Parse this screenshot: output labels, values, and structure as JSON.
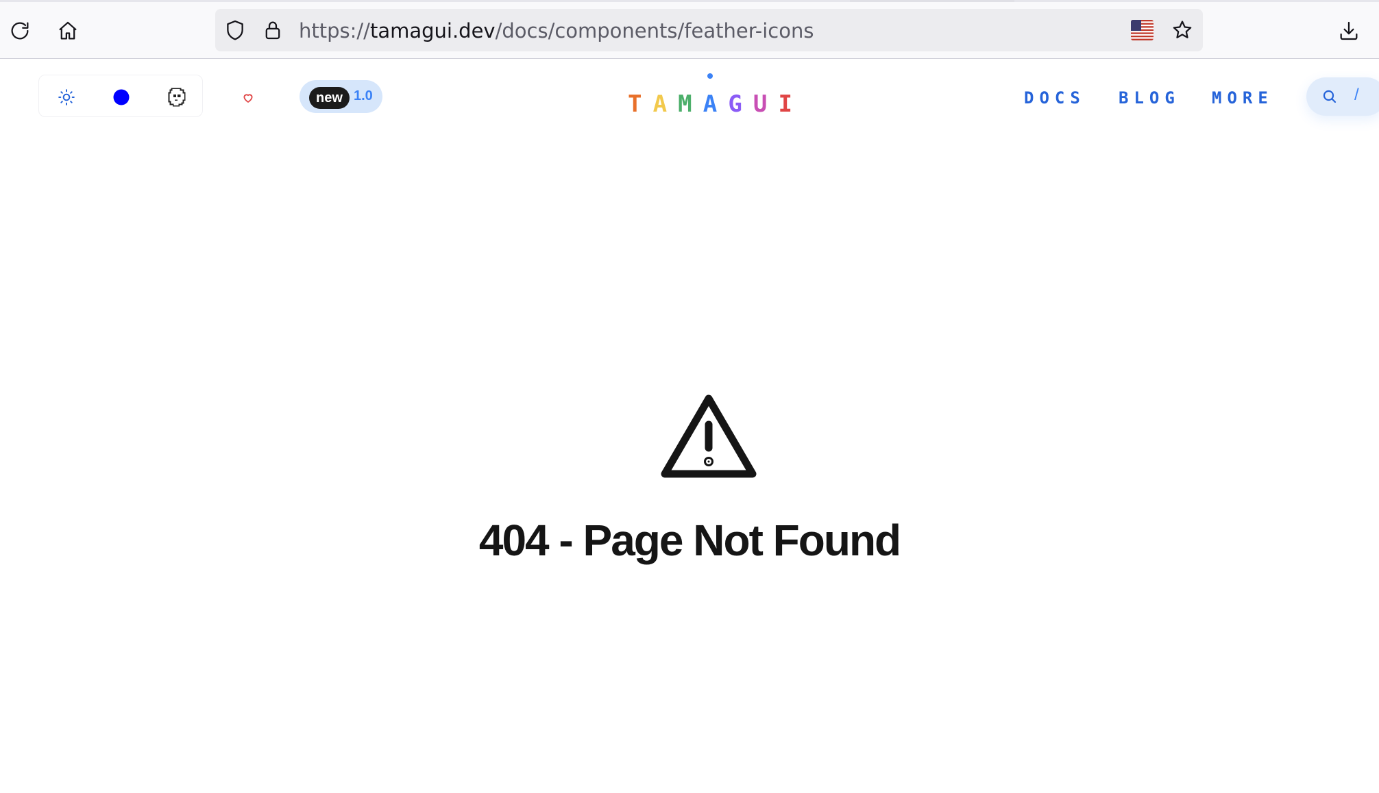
{
  "browser": {
    "url_scheme": "https://",
    "url_host": "tamagui.dev",
    "url_path": "/docs/components/feather-icons",
    "icons": [
      "reload-icon",
      "home-icon",
      "shield-icon",
      "lock-icon",
      "us-flag-icon",
      "star-icon",
      "download-icon"
    ]
  },
  "nav": {
    "new_badge": "new",
    "new_version": "1.0",
    "logo_letters": [
      "T",
      "A",
      "M",
      "A",
      "G",
      "U",
      "I"
    ],
    "logo_colors": [
      "#e8702a",
      "#f2c94c",
      "#4caf6a",
      "#3b82f6",
      "#8b5cf6",
      "#c84fb4",
      "#e04545"
    ],
    "links": [
      "DOCS",
      "BLOG",
      "MORE"
    ],
    "search_shortcut": "/",
    "colors": {
      "link": "#2563d9",
      "accent": "#3b82f6",
      "theme_dot": "#0000ff",
      "heart": "#e04545"
    }
  },
  "main": {
    "title": "404 - Page Not Found",
    "icon": "alert-triangle-icon"
  }
}
